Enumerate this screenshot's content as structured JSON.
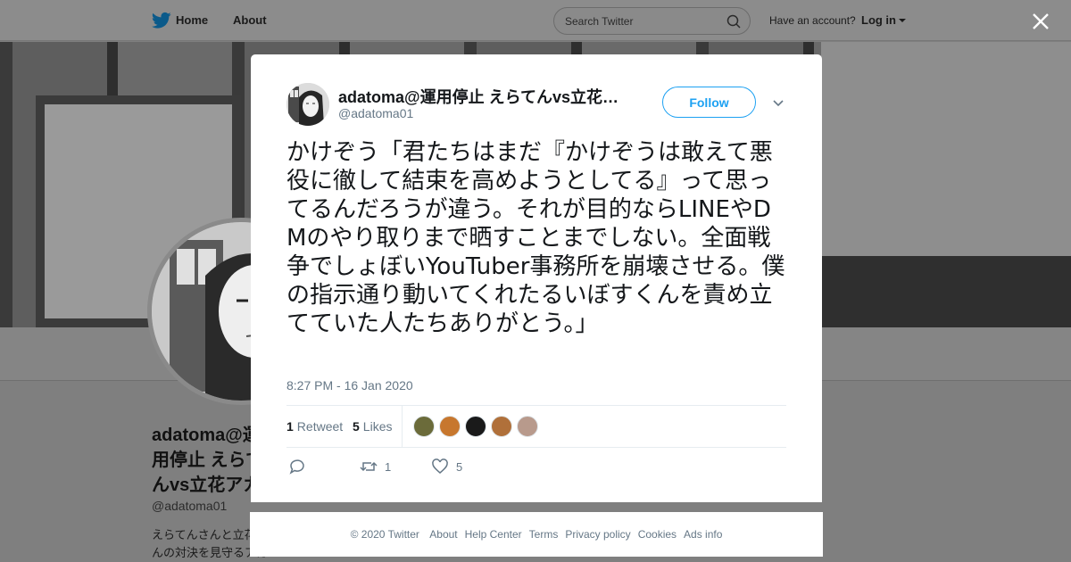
{
  "topbar": {
    "home_label": "Home",
    "about_label": "About",
    "search_placeholder": "Search Twitter",
    "have_account": "Have an account?",
    "login_label": "Log in"
  },
  "profile_background": {
    "name": "adatoma@運用停止 えらてんvs立花アカウントの",
    "handle": "@adatoma01",
    "bio": "えらてんさんと立花さんの対決を見守るアカウント。"
  },
  "tweet": {
    "display_name": "adatoma@運用停止 えらてんvs立花…",
    "screen_name": "@adatoma01",
    "follow_label": "Follow",
    "text": "かけぞう「君たちはまだ『かけぞうは敢えて悪役に徹して結束を高めようとしてる』って思ってるんだろうが違う。それが目的ならLINEやDMのやり取りまで晒すことまでしない。全面戦争でしょぼいYouTuber事務所を崩壊させる。僕の指示通り動いてくれたるいぼすくんを責め立てていた人たちありがとう。」",
    "timestamp": "8:27 PM - 16 Jan 2020",
    "retweets_count": "1",
    "retweets_label": "Retweet",
    "likes_count": "5",
    "likes_label": "Likes",
    "likers": [
      {
        "color": "#6b6b3a"
      },
      {
        "color": "#c7772e"
      },
      {
        "color": "#1a1a1a"
      },
      {
        "color": "#b0703a"
      },
      {
        "color": "#b89a8c"
      }
    ],
    "action_retweet_count": "1",
    "action_like_count": "5"
  },
  "footer": {
    "copyright": "© 2020 Twitter",
    "links": [
      "About",
      "Help Center",
      "Terms",
      "Privacy policy",
      "Cookies",
      "Ads info"
    ]
  },
  "colors": {
    "accent": "#1da1f2",
    "text": "#14171a",
    "secondary": "#657786"
  }
}
